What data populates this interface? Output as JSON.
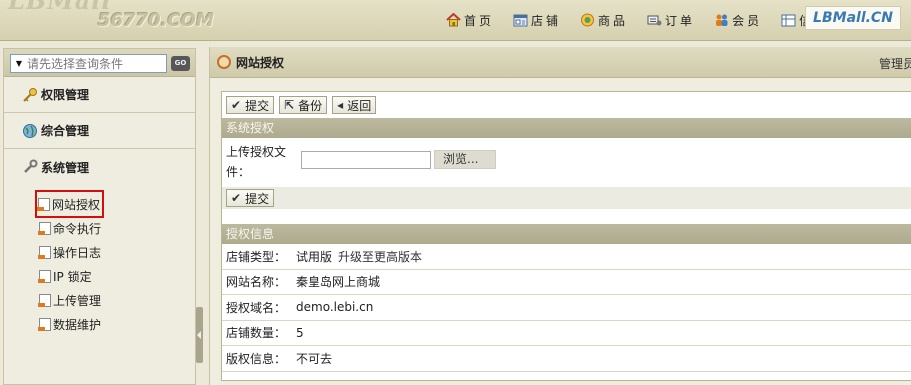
{
  "header": {
    "logo_top": "LBMall",
    "logo_sub": "56770.COM",
    "brand": "LBMall.CN",
    "nav": [
      {
        "label": "首页",
        "icon": "home-icon"
      },
      {
        "label": "店铺",
        "icon": "store-icon"
      },
      {
        "label": "商品",
        "icon": "goods-icon"
      },
      {
        "label": "订单",
        "icon": "order-icon"
      },
      {
        "label": "会员",
        "icon": "member-icon"
      },
      {
        "label": "信",
        "icon": "info-icon"
      }
    ]
  },
  "sidebar": {
    "search_placeholder": "请先选择查询条件",
    "go_label": "GO",
    "groups": [
      {
        "label": "权限管理",
        "icon": "key-icon"
      },
      {
        "label": "系统管理",
        "icon": "wrench-icon"
      },
      {
        "label": "综合管理",
        "icon": "globe-icon"
      }
    ],
    "items": [
      {
        "label": "网站授权"
      },
      {
        "label": "命令执行"
      },
      {
        "label": "操作日志"
      },
      {
        "label": "IP 锁定"
      },
      {
        "label": "上传管理"
      },
      {
        "label": "数据维护"
      }
    ]
  },
  "main": {
    "title": "网站授权",
    "admin_label": "管理员",
    "toolbar": {
      "submit": "提交",
      "backup": "备份",
      "back": "返回"
    },
    "section_auth": "系统授权",
    "upload_label": "上传授权文件：",
    "browse_label": "浏览...",
    "submit2": "提交",
    "section_info": "授权信息",
    "info": [
      {
        "key": "店铺类型：",
        "value": "试用版",
        "extra": "升级至更高版本"
      },
      {
        "key": "网站名称：",
        "value": "秦皇岛网上商城"
      },
      {
        "key": "授权域名：",
        "value": "demo.lebi.cn"
      },
      {
        "key": "店铺数量：",
        "value": "5"
      },
      {
        "key": "版权信息：",
        "value": "不可去"
      }
    ]
  }
}
